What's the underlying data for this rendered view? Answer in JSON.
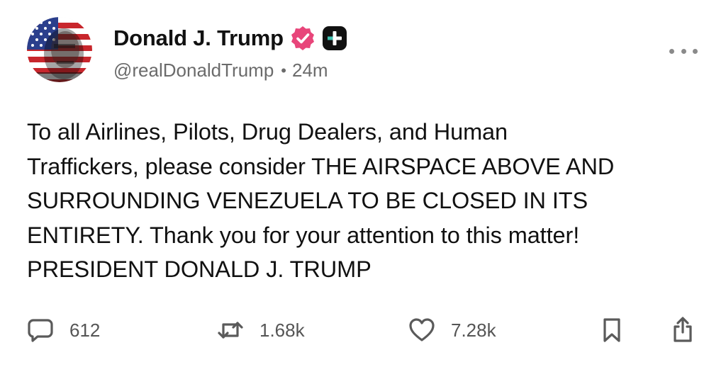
{
  "author": {
    "display_name": "Donald J. Trump",
    "handle": "@realDonaldTrump",
    "time_ago": "24m",
    "separator": "•",
    "avatar_icon": "portrait-avatar-flag",
    "verified_badge_icon": "verified-check-icon",
    "plus_badge_icon": "plus-badge-icon"
  },
  "post": {
    "lines": [
      "To all Airlines, Pilots, Drug Dealers, and Human",
      "Traffickers, please consider THE AIRSPACE ABOVE AND",
      "SURROUNDING VENEZUELA TO BE CLOSED IN ITS",
      "ENTIRETY. Thank you for your attention to this matter!",
      "PRESIDENT DONALD J. TRUMP"
    ]
  },
  "actions": {
    "reply": {
      "icon": "reply-bubble-icon",
      "count": "612"
    },
    "repost": {
      "icon": "repost-arrows-icon",
      "count": "1.68k"
    },
    "like": {
      "icon": "heart-icon",
      "count": "7.28k"
    },
    "bookmark": {
      "icon": "bookmark-icon"
    },
    "share": {
      "icon": "share-icon"
    }
  },
  "colors": {
    "verified_badge": "#e8457a",
    "text_primary": "#111111",
    "text_secondary": "#6b6b6b",
    "icon_gray": "#5a5a5a"
  }
}
